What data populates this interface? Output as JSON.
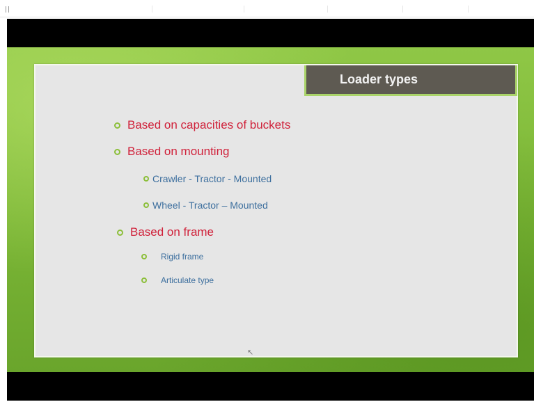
{
  "slide": {
    "title": "Loader types",
    "bullets": [
      {
        "level": 1,
        "text": "Based on capacities of buckets"
      },
      {
        "level": 1,
        "text": "Based on mounting"
      },
      {
        "level": 2,
        "text": "Crawler - Tractor - Mounted"
      },
      {
        "level": 2,
        "text": "Wheel - Tractor – Mounted"
      },
      {
        "level": 1,
        "text": "Based on frame"
      },
      {
        "level": 3,
        "text": "Rigid frame"
      },
      {
        "level": 3,
        "text": "Articulate type"
      }
    ]
  },
  "colors": {
    "level1_text": "#d0213a",
    "sub_text": "#3d6f9e",
    "bullet": "#8cbf3a",
    "title_bg": "#5e5a52",
    "slide_green": "#7ab535"
  },
  "icons": {
    "bullet": "circle-bullet-icon",
    "cursor": "mouse-cursor-icon"
  }
}
